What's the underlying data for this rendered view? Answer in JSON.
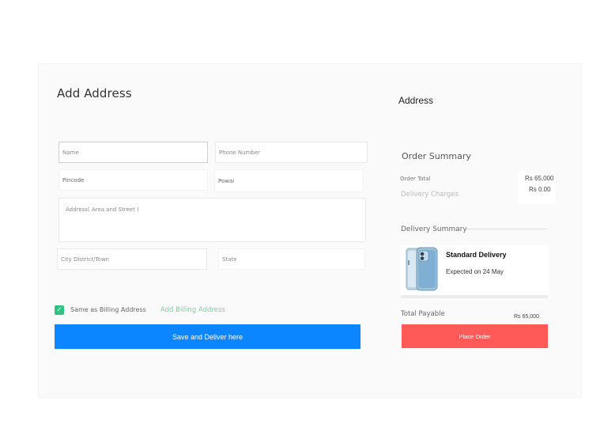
{
  "address_form": {
    "title": "Add Address",
    "name_placeholder": "Name",
    "phone_placeholder": "Phone Number",
    "pincode_value": "Pincode",
    "locality_value": "Powai",
    "address_placeholder": "Address( Area and Street )",
    "city_placeholder": "City District/Town",
    "state_placeholder": "State",
    "same_as_billing_label": "Same as Billing Address",
    "same_as_billing_checked": true,
    "add_billing_link": "Add Billing Address",
    "save_button": "Save and Deliver here"
  },
  "sidebar": {
    "title": "Address",
    "order_summary": {
      "title": "Order Summary",
      "order_total_label": "Order Total",
      "order_total_value": "Rs 65,000",
      "delivery_charges_label": "Delivery Charges",
      "delivery_charges_value": "Rs 0.00"
    },
    "delivery_summary": {
      "title": "Delivery Summary",
      "delivery_type": "Standard Delivery",
      "expected": "Expected on 24 May",
      "product_icon": "phone-product-icon"
    },
    "total_payable_label": "Total Payable",
    "total_payable_value": "Rs 65,000",
    "place_order_button": "Place Order"
  },
  "colors": {
    "save_button": "#0b86ff",
    "place_order_button": "#ff5a57",
    "checkbox": "#2ec27e",
    "link": "#7fcfa0"
  }
}
